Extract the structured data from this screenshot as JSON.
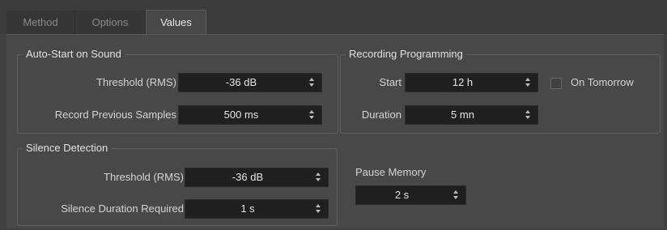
{
  "tabs": [
    {
      "label": "Method",
      "active": false
    },
    {
      "label": "Options",
      "active": false
    },
    {
      "label": "Values",
      "active": true
    }
  ],
  "auto_start": {
    "title": "Auto-Start on Sound",
    "threshold": {
      "label": "Threshold (RMS)",
      "value": "-36 dB"
    },
    "record_previous": {
      "label": "Record Previous Samples",
      "value": "500 ms"
    }
  },
  "recording_programming": {
    "title": "Recording Programming",
    "start": {
      "label": "Start",
      "value": "12 h"
    },
    "on_tomorrow": {
      "label": "On Tomorrow",
      "checked": false
    },
    "duration": {
      "label": "Duration",
      "value": "5 mn"
    }
  },
  "silence_detection": {
    "title": "Silence Detection",
    "threshold": {
      "label": "Threshold (RMS)",
      "value": "-36 dB"
    },
    "silence_duration": {
      "label": "Silence Duration Required",
      "value": "1 s"
    }
  },
  "pause_memory": {
    "label": "Pause Memory",
    "value": "2 s"
  },
  "colors": {
    "background": "#414141",
    "panel": "#484848",
    "field": "#1f1f1f",
    "text": "#d6d6d6"
  }
}
